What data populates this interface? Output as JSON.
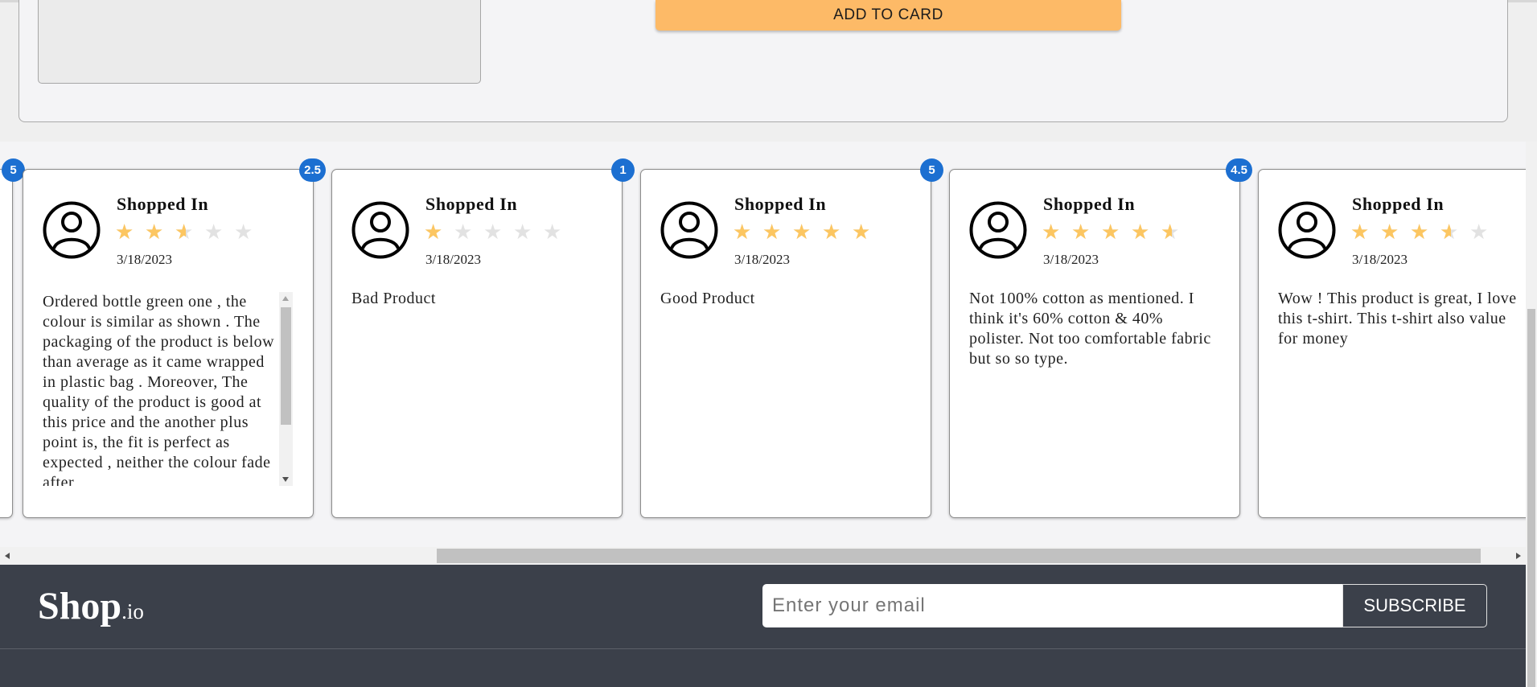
{
  "product": {
    "add_to_cart_label": "ADD TO CARD"
  },
  "reviews": {
    "partial_left_badge": "5",
    "cards": [
      {
        "badge": "2.5",
        "title": "Shopped In",
        "rating": 2.5,
        "date": "3/18/2023",
        "text": "Ordered bottle green one , the colour is similar as shown . The packaging of the product is below than average as it came wrapped in plastic bag . Moreover, The quality of the product is good at this price and the another plus point is, the fit is perfect as expected , neither the colour fade after"
      },
      {
        "badge": "1",
        "title": "Shopped In",
        "rating": 1,
        "date": "3/18/2023",
        "text": "Bad Product"
      },
      {
        "badge": "5",
        "title": "Shopped In",
        "rating": 5,
        "date": "3/18/2023",
        "text": "Good Product"
      },
      {
        "badge": "4.5",
        "title": "Shopped In",
        "rating": 4.5,
        "date": "3/18/2023",
        "text": "Not 100% cotton as mentioned. I think it's 60% cotton & 40% polister. Not too comfortable fabric but so so type."
      },
      {
        "badge": "",
        "title": "Shopped In",
        "rating": 3.5,
        "date": "3/18/2023",
        "text": "Wow ! This product is great, I love this t-shirt. This t-shirt also value for money"
      }
    ],
    "star_icon": "star-icon",
    "avatar_icon": "user-circle-icon",
    "colors": {
      "badge": "#1c6fd1",
      "star_filled": "#fcc661",
      "star_empty": "#e2e2e2"
    }
  },
  "footer": {
    "logo_main": "Shop",
    "logo_suffix": ".io",
    "email_placeholder": "Enter your email",
    "subscribe_label": "SUBSCRIBE",
    "background_color": "#3b404a"
  }
}
